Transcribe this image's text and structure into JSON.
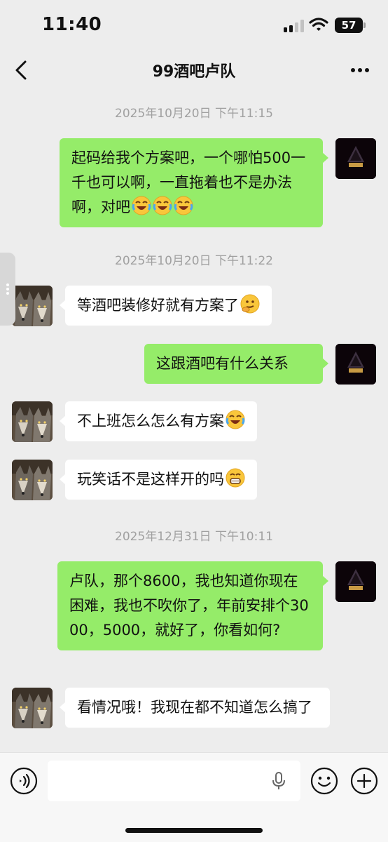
{
  "status_bar": {
    "time": "11:40",
    "battery": "57"
  },
  "header": {
    "title": "99酒吧卢队"
  },
  "colors": {
    "outgoing_bubble": "#95ec69",
    "incoming_bubble": "#ffffff",
    "background": "#ededed"
  },
  "messages": {
    "ts1": "2025年10月20日 下午11:15",
    "m1": "起码给我个方案吧，一个哪怕500一千也可以啊，一直拖着也不是办法啊，对吧",
    "ts2": "2025年10月20日 下午11:22",
    "m2": "等酒吧装修好就有方案了",
    "m3": "这跟酒吧有什么关系",
    "m4": "不上班怎么怎么有方案",
    "m5": "玩笑话不是这样开的吗",
    "ts3": "2025年12月31日 下午10:11",
    "m6": "卢队，那个8600，我也知道你现在困难，我也不吹你了，年前安排个3000，5000，就好了，你看如何?",
    "m7": "看情况哦！我现在都不知道怎么搞了"
  },
  "icons": {
    "back": "chevron-left-icon",
    "more": "more-dots-icon",
    "voice": "voice-icon",
    "mic": "mic-icon",
    "emoji": "emoji-icon",
    "plus": "plus-icon"
  }
}
